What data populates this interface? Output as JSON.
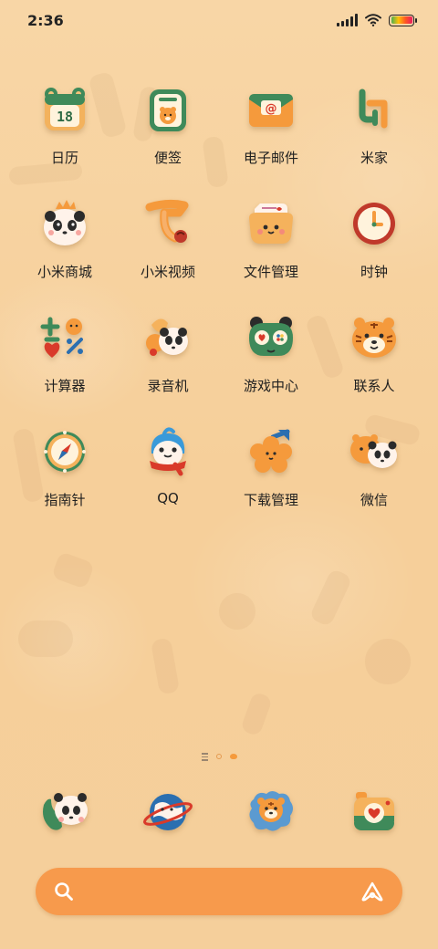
{
  "status_bar": {
    "time": "2:36",
    "icons": [
      "signal-icon",
      "wifi-icon",
      "battery-icon"
    ]
  },
  "apps": [
    {
      "label": "日历",
      "icon": "calendar-icon",
      "badge_text": "18"
    },
    {
      "label": "便签",
      "icon": "notes-icon"
    },
    {
      "label": "电子邮件",
      "icon": "email-icon"
    },
    {
      "label": "米家",
      "icon": "mijia-icon"
    },
    {
      "label": "小米商城",
      "icon": "mi-store-icon"
    },
    {
      "label": "小米视频",
      "icon": "mi-video-icon"
    },
    {
      "label": "文件管理",
      "icon": "file-manager-icon"
    },
    {
      "label": "时钟",
      "icon": "clock-icon"
    },
    {
      "label": "计算器",
      "icon": "calculator-icon"
    },
    {
      "label": "录音机",
      "icon": "recorder-icon"
    },
    {
      "label": "游戏中心",
      "icon": "game-center-icon"
    },
    {
      "label": "联系人",
      "icon": "contacts-icon"
    },
    {
      "label": "指南针",
      "icon": "compass-icon"
    },
    {
      "label": "QQ",
      "icon": "qq-icon"
    },
    {
      "label": "下载管理",
      "icon": "download-manager-icon"
    },
    {
      "label": "微信",
      "icon": "wechat-icon"
    }
  ],
  "page_indicator": {
    "pages": 3,
    "active": 2
  },
  "dock": [
    {
      "icon": "phone-icon"
    },
    {
      "icon": "browser-icon"
    },
    {
      "icon": "messages-icon"
    },
    {
      "icon": "camera-icon"
    }
  ],
  "search_bar": {
    "left_icon": "search-icon",
    "right_icon": "xiaoai-assistant-icon"
  },
  "colors": {
    "background": "#f7d3a1",
    "search_bar": "#f79a4c",
    "accent_orange": "#f59a3c",
    "accent_green": "#3f8a5a",
    "accent_red": "#d93a2a"
  }
}
